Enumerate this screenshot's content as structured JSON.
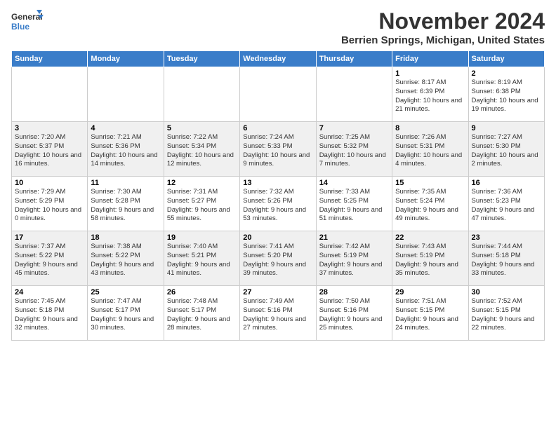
{
  "logo": {
    "line1": "General",
    "line2": "Blue"
  },
  "title": "November 2024",
  "subtitle": "Berrien Springs, Michigan, United States",
  "days_header": [
    "Sunday",
    "Monday",
    "Tuesday",
    "Wednesday",
    "Thursday",
    "Friday",
    "Saturday"
  ],
  "weeks": [
    [
      {
        "day": "",
        "info": ""
      },
      {
        "day": "",
        "info": ""
      },
      {
        "day": "",
        "info": ""
      },
      {
        "day": "",
        "info": ""
      },
      {
        "day": "",
        "info": ""
      },
      {
        "day": "1",
        "info": "Sunrise: 8:17 AM\nSunset: 6:39 PM\nDaylight: 10 hours and 21 minutes."
      },
      {
        "day": "2",
        "info": "Sunrise: 8:19 AM\nSunset: 6:38 PM\nDaylight: 10 hours and 19 minutes."
      }
    ],
    [
      {
        "day": "3",
        "info": "Sunrise: 7:20 AM\nSunset: 5:37 PM\nDaylight: 10 hours and 16 minutes."
      },
      {
        "day": "4",
        "info": "Sunrise: 7:21 AM\nSunset: 5:36 PM\nDaylight: 10 hours and 14 minutes."
      },
      {
        "day": "5",
        "info": "Sunrise: 7:22 AM\nSunset: 5:34 PM\nDaylight: 10 hours and 12 minutes."
      },
      {
        "day": "6",
        "info": "Sunrise: 7:24 AM\nSunset: 5:33 PM\nDaylight: 10 hours and 9 minutes."
      },
      {
        "day": "7",
        "info": "Sunrise: 7:25 AM\nSunset: 5:32 PM\nDaylight: 10 hours and 7 minutes."
      },
      {
        "day": "8",
        "info": "Sunrise: 7:26 AM\nSunset: 5:31 PM\nDaylight: 10 hours and 4 minutes."
      },
      {
        "day": "9",
        "info": "Sunrise: 7:27 AM\nSunset: 5:30 PM\nDaylight: 10 hours and 2 minutes."
      }
    ],
    [
      {
        "day": "10",
        "info": "Sunrise: 7:29 AM\nSunset: 5:29 PM\nDaylight: 10 hours and 0 minutes."
      },
      {
        "day": "11",
        "info": "Sunrise: 7:30 AM\nSunset: 5:28 PM\nDaylight: 9 hours and 58 minutes."
      },
      {
        "day": "12",
        "info": "Sunrise: 7:31 AM\nSunset: 5:27 PM\nDaylight: 9 hours and 55 minutes."
      },
      {
        "day": "13",
        "info": "Sunrise: 7:32 AM\nSunset: 5:26 PM\nDaylight: 9 hours and 53 minutes."
      },
      {
        "day": "14",
        "info": "Sunrise: 7:33 AM\nSunset: 5:25 PM\nDaylight: 9 hours and 51 minutes."
      },
      {
        "day": "15",
        "info": "Sunrise: 7:35 AM\nSunset: 5:24 PM\nDaylight: 9 hours and 49 minutes."
      },
      {
        "day": "16",
        "info": "Sunrise: 7:36 AM\nSunset: 5:23 PM\nDaylight: 9 hours and 47 minutes."
      }
    ],
    [
      {
        "day": "17",
        "info": "Sunrise: 7:37 AM\nSunset: 5:22 PM\nDaylight: 9 hours and 45 minutes."
      },
      {
        "day": "18",
        "info": "Sunrise: 7:38 AM\nSunset: 5:22 PM\nDaylight: 9 hours and 43 minutes."
      },
      {
        "day": "19",
        "info": "Sunrise: 7:40 AM\nSunset: 5:21 PM\nDaylight: 9 hours and 41 minutes."
      },
      {
        "day": "20",
        "info": "Sunrise: 7:41 AM\nSunset: 5:20 PM\nDaylight: 9 hours and 39 minutes."
      },
      {
        "day": "21",
        "info": "Sunrise: 7:42 AM\nSunset: 5:19 PM\nDaylight: 9 hours and 37 minutes."
      },
      {
        "day": "22",
        "info": "Sunrise: 7:43 AM\nSunset: 5:19 PM\nDaylight: 9 hours and 35 minutes."
      },
      {
        "day": "23",
        "info": "Sunrise: 7:44 AM\nSunset: 5:18 PM\nDaylight: 9 hours and 33 minutes."
      }
    ],
    [
      {
        "day": "24",
        "info": "Sunrise: 7:45 AM\nSunset: 5:18 PM\nDaylight: 9 hours and 32 minutes."
      },
      {
        "day": "25",
        "info": "Sunrise: 7:47 AM\nSunset: 5:17 PM\nDaylight: 9 hours and 30 minutes."
      },
      {
        "day": "26",
        "info": "Sunrise: 7:48 AM\nSunset: 5:17 PM\nDaylight: 9 hours and 28 minutes."
      },
      {
        "day": "27",
        "info": "Sunrise: 7:49 AM\nSunset: 5:16 PM\nDaylight: 9 hours and 27 minutes."
      },
      {
        "day": "28",
        "info": "Sunrise: 7:50 AM\nSunset: 5:16 PM\nDaylight: 9 hours and 25 minutes."
      },
      {
        "day": "29",
        "info": "Sunrise: 7:51 AM\nSunset: 5:15 PM\nDaylight: 9 hours and 24 minutes."
      },
      {
        "day": "30",
        "info": "Sunrise: 7:52 AM\nSunset: 5:15 PM\nDaylight: 9 hours and 22 minutes."
      }
    ]
  ]
}
